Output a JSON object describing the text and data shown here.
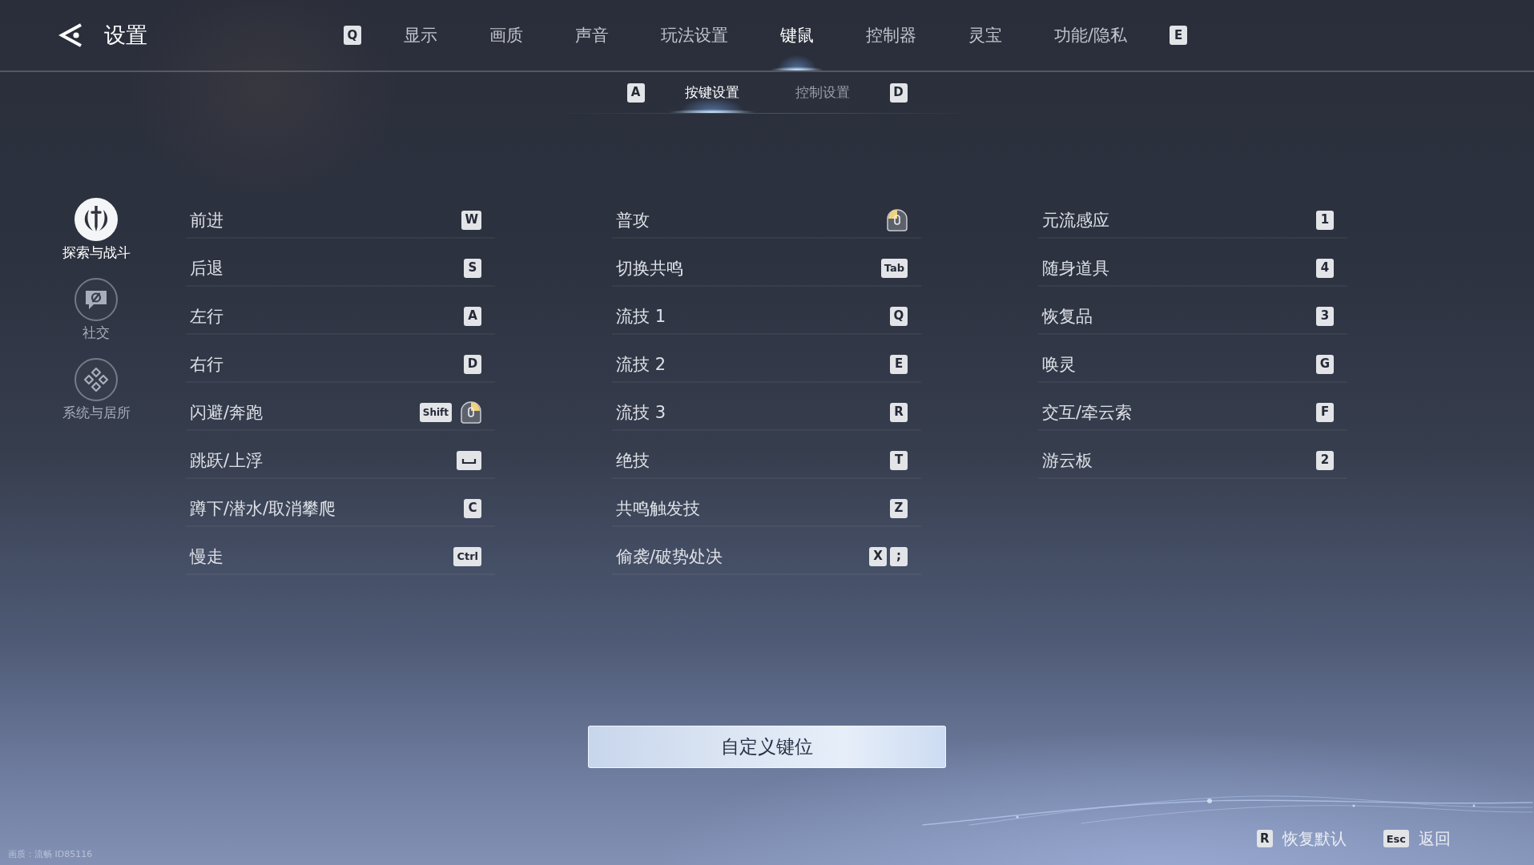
{
  "header": {
    "title": "设置"
  },
  "tabs": {
    "prev_key": "Q",
    "items": [
      {
        "label": "显示",
        "selected": false
      },
      {
        "label": "画质",
        "selected": false
      },
      {
        "label": "声音",
        "selected": false
      },
      {
        "label": "玩法设置",
        "selected": false
      },
      {
        "label": "键鼠",
        "selected": true
      },
      {
        "label": "控制器",
        "selected": false
      },
      {
        "label": "灵宝",
        "selected": false
      },
      {
        "label": "功能/隐私",
        "selected": false
      }
    ],
    "next_key": "E"
  },
  "subtabs": {
    "prev_key": "A",
    "items": [
      {
        "label": "按键设置",
        "selected": true
      },
      {
        "label": "控制设置",
        "selected": false
      }
    ],
    "next_key": "D"
  },
  "sidebar": {
    "items": [
      {
        "label": "探索与战斗",
        "selected": true
      },
      {
        "label": "社交",
        "selected": false
      },
      {
        "label": "系统与居所",
        "selected": false
      }
    ]
  },
  "bindings": {
    "columns": [
      {
        "rows": [
          {
            "action": "前进",
            "keys": [
              {
                "kind": "key",
                "label": "W"
              }
            ]
          },
          {
            "action": "后退",
            "keys": [
              {
                "kind": "key",
                "label": "S"
              }
            ]
          },
          {
            "action": "左行",
            "keys": [
              {
                "kind": "key",
                "label": "A"
              }
            ]
          },
          {
            "action": "右行",
            "keys": [
              {
                "kind": "key",
                "label": "D"
              }
            ]
          },
          {
            "action": "闪避/奔跑",
            "keys": [
              {
                "kind": "key",
                "label": "Shift"
              },
              {
                "kind": "mouse",
                "left_lit": false,
                "right_lit": true
              }
            ]
          },
          {
            "action": "跳跃/上浮",
            "keys": [
              {
                "kind": "space"
              }
            ]
          },
          {
            "action": "蹲下/潜水/取消攀爬",
            "keys": [
              {
                "kind": "key",
                "label": "C"
              }
            ]
          },
          {
            "action": "慢走",
            "keys": [
              {
                "kind": "key",
                "label": "Ctrl"
              }
            ]
          }
        ]
      },
      {
        "rows": [
          {
            "action": "普攻",
            "keys": [
              {
                "kind": "mouse",
                "left_lit": true,
                "right_lit": false
              }
            ]
          },
          {
            "action": "切换共鸣",
            "keys": [
              {
                "kind": "key",
                "label": "Tab"
              }
            ]
          },
          {
            "action": "流技 1",
            "keys": [
              {
                "kind": "key",
                "label": "Q"
              }
            ]
          },
          {
            "action": "流技 2",
            "keys": [
              {
                "kind": "key",
                "label": "E"
              }
            ]
          },
          {
            "action": "流技 3",
            "keys": [
              {
                "kind": "key",
                "label": "R"
              }
            ]
          },
          {
            "action": "绝技",
            "keys": [
              {
                "kind": "key",
                "label": "T"
              }
            ]
          },
          {
            "action": "共鸣触发技",
            "keys": [
              {
                "kind": "key",
                "label": "Z"
              }
            ]
          },
          {
            "action": "偷袭/破势处决",
            "keys": [
              {
                "kind": "key",
                "label": "X"
              },
              {
                "kind": "key",
                "label": ";"
              }
            ]
          }
        ]
      },
      {
        "rows": [
          {
            "action": "元流感应",
            "keys": [
              {
                "kind": "key",
                "label": "1"
              }
            ]
          },
          {
            "action": "随身道具",
            "keys": [
              {
                "kind": "key",
                "label": "4"
              }
            ]
          },
          {
            "action": "恢复品",
            "keys": [
              {
                "kind": "key",
                "label": "3"
              }
            ]
          },
          {
            "action": "唤灵",
            "keys": [
              {
                "kind": "key",
                "label": "G"
              }
            ]
          },
          {
            "action": "交互/牵云索",
            "keys": [
              {
                "kind": "key",
                "label": "F"
              }
            ]
          },
          {
            "action": "游云板",
            "keys": [
              {
                "kind": "key",
                "label": "2"
              }
            ]
          }
        ]
      }
    ]
  },
  "customize_button": {
    "label": "自定义键位"
  },
  "footer": {
    "build_info": "画质：流畅 ID85116",
    "actions": [
      {
        "key": "R",
        "label": "恢复默认"
      },
      {
        "key": "Esc",
        "label": "返回"
      }
    ]
  }
}
